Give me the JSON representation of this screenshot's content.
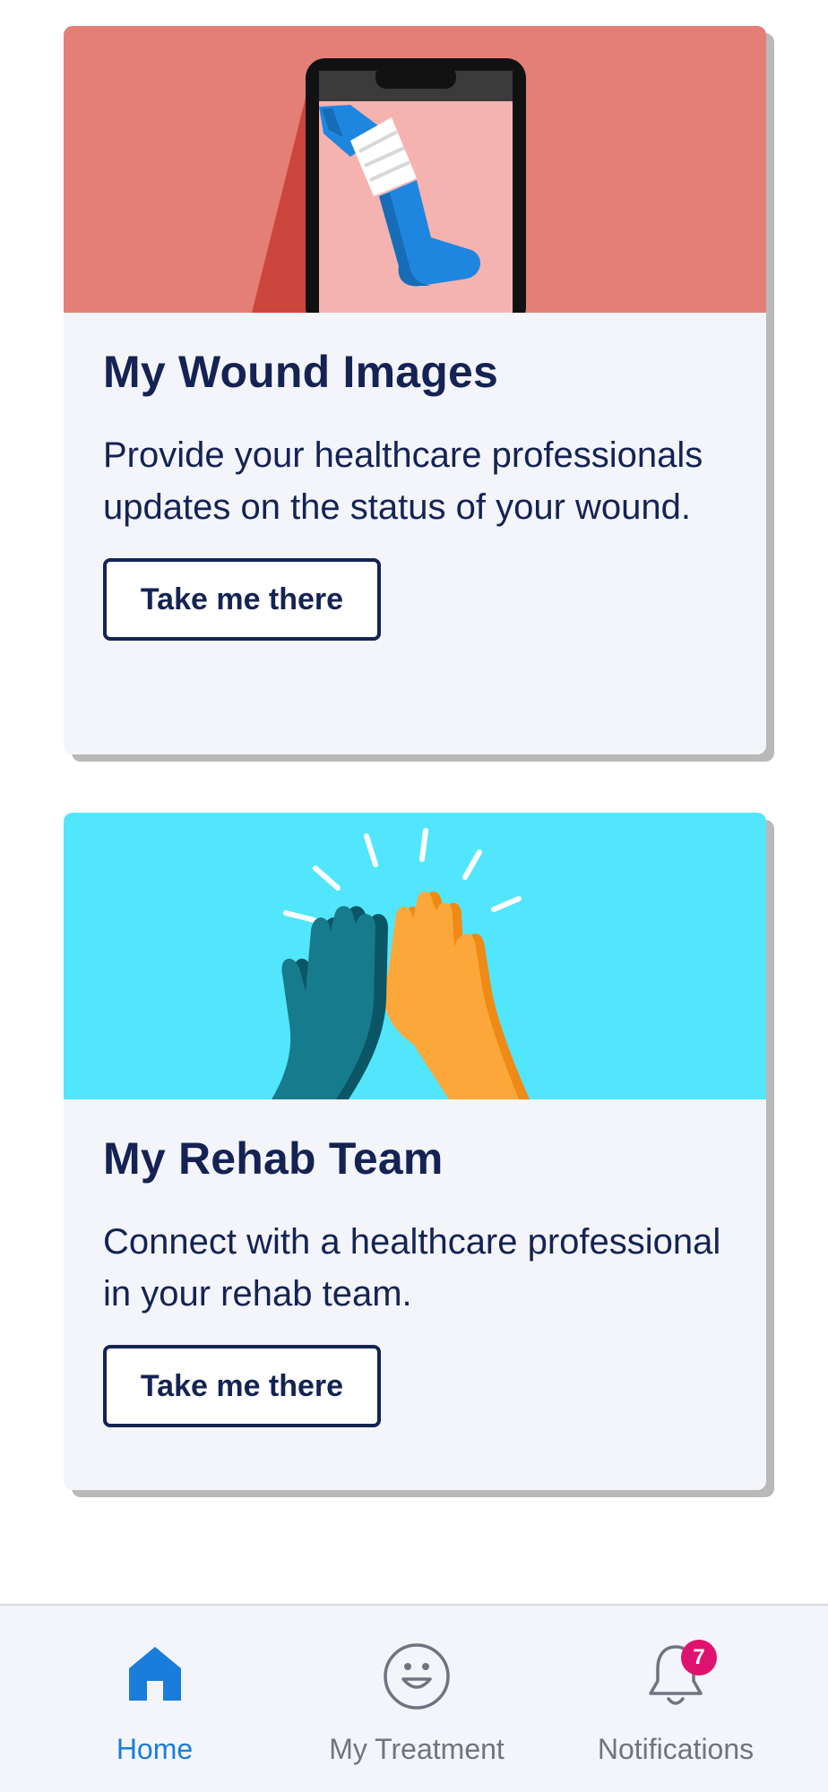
{
  "cards": [
    {
      "title": "My Wound Images",
      "description": "Provide your healthcare professionals updates on the status of your wound.",
      "button_label": "Take me there",
      "image_icon": "phone-leg-bandage-illustration",
      "image_bg": "#e47f78"
    },
    {
      "title": "My Rehab Team",
      "description": "Connect with a healthcare professional in your rehab team.",
      "button_label": "Take me there",
      "image_icon": "high-five-illustration",
      "image_bg": "#52e6fd"
    }
  ],
  "bottom_nav": {
    "items": [
      {
        "label": "Home",
        "icon": "home-icon",
        "active": true
      },
      {
        "label": "My Treatment",
        "icon": "smiley-face-icon",
        "active": false
      },
      {
        "label": "Notifications",
        "icon": "bell-icon",
        "active": false,
        "badge": "7"
      }
    ]
  },
  "colors": {
    "primary_text": "#142353",
    "active_nav": "#1a7ddb",
    "inactive_nav": "#6f7480",
    "badge": "#e0126f",
    "card_bg": "#f4f5fb"
  }
}
